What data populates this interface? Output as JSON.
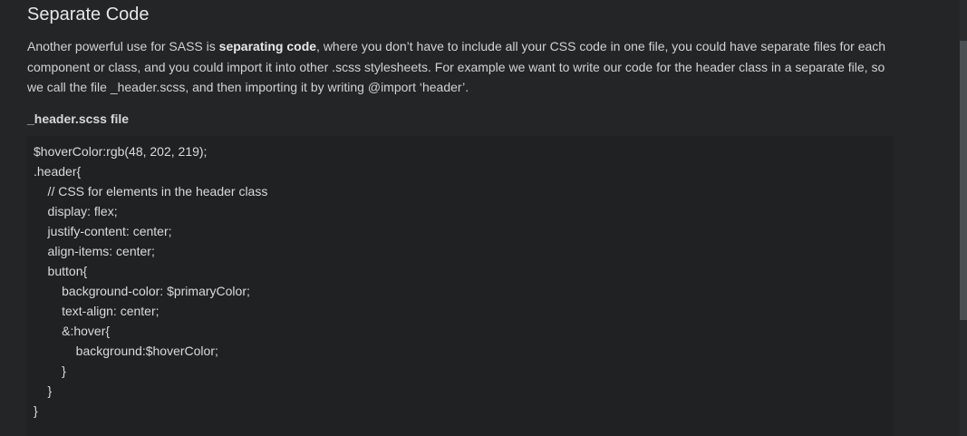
{
  "section": {
    "title": "Separate Code",
    "paragraph": {
      "before_bold": "Another powerful use for SASS is ",
      "bold": "separating code",
      "after_bold": ", where you don’t have to include all your CSS code in one file, you could have separate files for each component or class, and you could import it into other .scss stylesheets. For example we want to write our code for the header class in a separate file, so we call the file _header.scss, and then importing it by writing @import ‘header’."
    },
    "file_label": "_header.scss file"
  },
  "code": {
    "lines": [
      "$hoverColor:rgb(48, 202, 219);",
      ".header{",
      "    // CSS for elements in the header class",
      "    display: flex;",
      "    justify-content: center;",
      "    align-items: center;",
      "    button{",
      "        background-color: $primaryColor;",
      "        text-align: center;",
      "        &:hover{",
      "            background:$hoverColor;",
      "        }",
      "    }",
      "}"
    ]
  }
}
